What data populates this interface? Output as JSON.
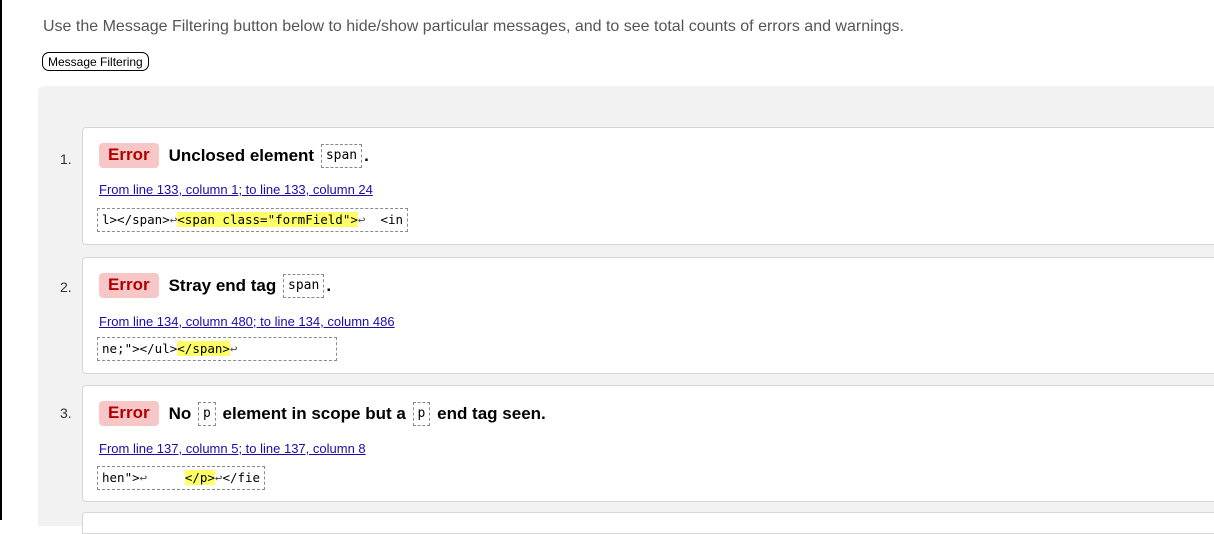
{
  "intro_text": "Use the Message Filtering button below to hide/show particular messages, and to see total counts of errors and warnings.",
  "filter_button_label": "Message Filtering",
  "messages": [
    {
      "number": "1.",
      "type": "Error",
      "text_before": "Unclosed element",
      "code1": "span",
      "text_mid": ".",
      "code2": "",
      "text_after": "",
      "location": "From line 133, column 1; to line 133, column 24",
      "extract_pre": "l></span>",
      "extract_ret1": "↩",
      "extract_hl": "<span class=\"formField\">",
      "extract_ret2": "↩",
      "extract_post": "  <in"
    },
    {
      "number": "2.",
      "type": "Error",
      "text_before": "Stray end tag",
      "code1": "span",
      "text_mid": ".",
      "code2": "",
      "text_after": "",
      "location": "From line 134, column 480; to line 134, column 486",
      "extract_pre": "ne;\"></ul>",
      "extract_ret1": "",
      "extract_hl": "</span>",
      "extract_ret2": "↩",
      "extract_post": ""
    },
    {
      "number": "3.",
      "type": "Error",
      "text_before": "No",
      "code1": "p",
      "text_mid": "element in scope but a",
      "code2": "p",
      "text_after": "end tag seen.",
      "location": "From line 137, column 5; to line 137, column 8",
      "extract_pre": "hen\">",
      "extract_ret1": "↩",
      "extract_hl": "</p>",
      "extract_ret2": "↩",
      "extract_post": "</fie"
    }
  ],
  "colors": {
    "error_badge_bg": "#f7c6c6",
    "error_badge_text": "#b20000",
    "highlight": "#ffff66",
    "link": "#1a0dab"
  }
}
